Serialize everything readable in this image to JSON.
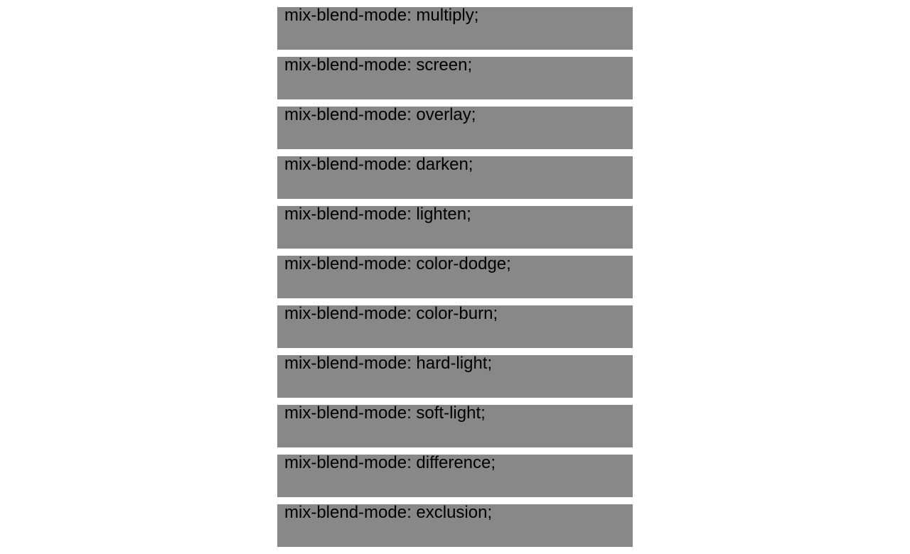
{
  "blend_modes": [
    {
      "label": "mix-blend-mode: multiply;"
    },
    {
      "label": "mix-blend-mode: screen;"
    },
    {
      "label": "mix-blend-mode: overlay;"
    },
    {
      "label": "mix-blend-mode: darken;"
    },
    {
      "label": "mix-blend-mode: lighten;"
    },
    {
      "label": "mix-blend-mode: color-dodge;"
    },
    {
      "label": "mix-blend-mode: color-burn;"
    },
    {
      "label": "mix-blend-mode: hard-light;"
    },
    {
      "label": "mix-blend-mode: soft-light;"
    },
    {
      "label": "mix-blend-mode: difference;"
    },
    {
      "label": "mix-blend-mode: exclusion;"
    }
  ],
  "colors": {
    "box_background": "#888888",
    "text": "#000000",
    "page_background": "#ffffff"
  }
}
